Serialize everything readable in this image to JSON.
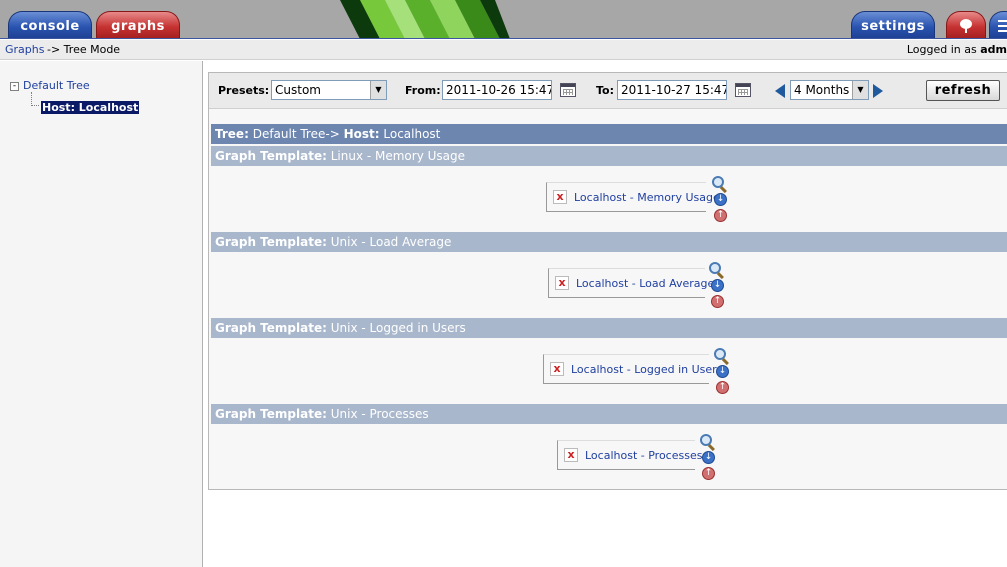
{
  "tabs": {
    "console": "console",
    "graphs": "graphs",
    "settings": "settings"
  },
  "breadcrumb": {
    "link": "Graphs",
    "rest": "-> Tree Mode",
    "login_prefix": "Logged in as",
    "login_user": "adm"
  },
  "tree": {
    "root_label": "Default Tree",
    "expander": "-",
    "host_label": "Host: Localhost"
  },
  "filter": {
    "presets_label": "Presets:",
    "preset_value": "Custom",
    "from_label": "From:",
    "from_value": "2011-10-26 15:47",
    "to_label": "To:",
    "to_value": "2011-10-27 15:47",
    "span_value": "4 Months",
    "refresh_label": "refresh"
  },
  "header": {
    "tree_label": "Tree:",
    "tree_value": "Default Tree->",
    "host_label": "Host:",
    "host_value": "Localhost"
  },
  "templates": [
    {
      "label": "Graph Template:",
      "name": "Linux - Memory Usage",
      "graph": "Localhost - Memory Usage"
    },
    {
      "label": "Graph Template:",
      "name": "Unix - Load Average",
      "graph": "Localhost - Load Average"
    },
    {
      "label": "Graph Template:",
      "name": "Unix - Logged in Users",
      "graph": "Localhost - Logged in Users"
    },
    {
      "label": "Graph Template:",
      "name": "Unix - Processes",
      "graph": "Localhost - Processes"
    }
  ],
  "icons": {
    "broken_image": "x",
    "download": "↓",
    "upload": "↑",
    "select_arrow": "▼",
    "tree_tab": "tree-icon",
    "list_tab": "list-icon"
  },
  "colors": {
    "tab_blue": "#2a54b0",
    "tab_red": "#c63232",
    "tree_header": "#6d86b0",
    "template_header": "#a9b7cc",
    "link": "#1f3fa0"
  }
}
